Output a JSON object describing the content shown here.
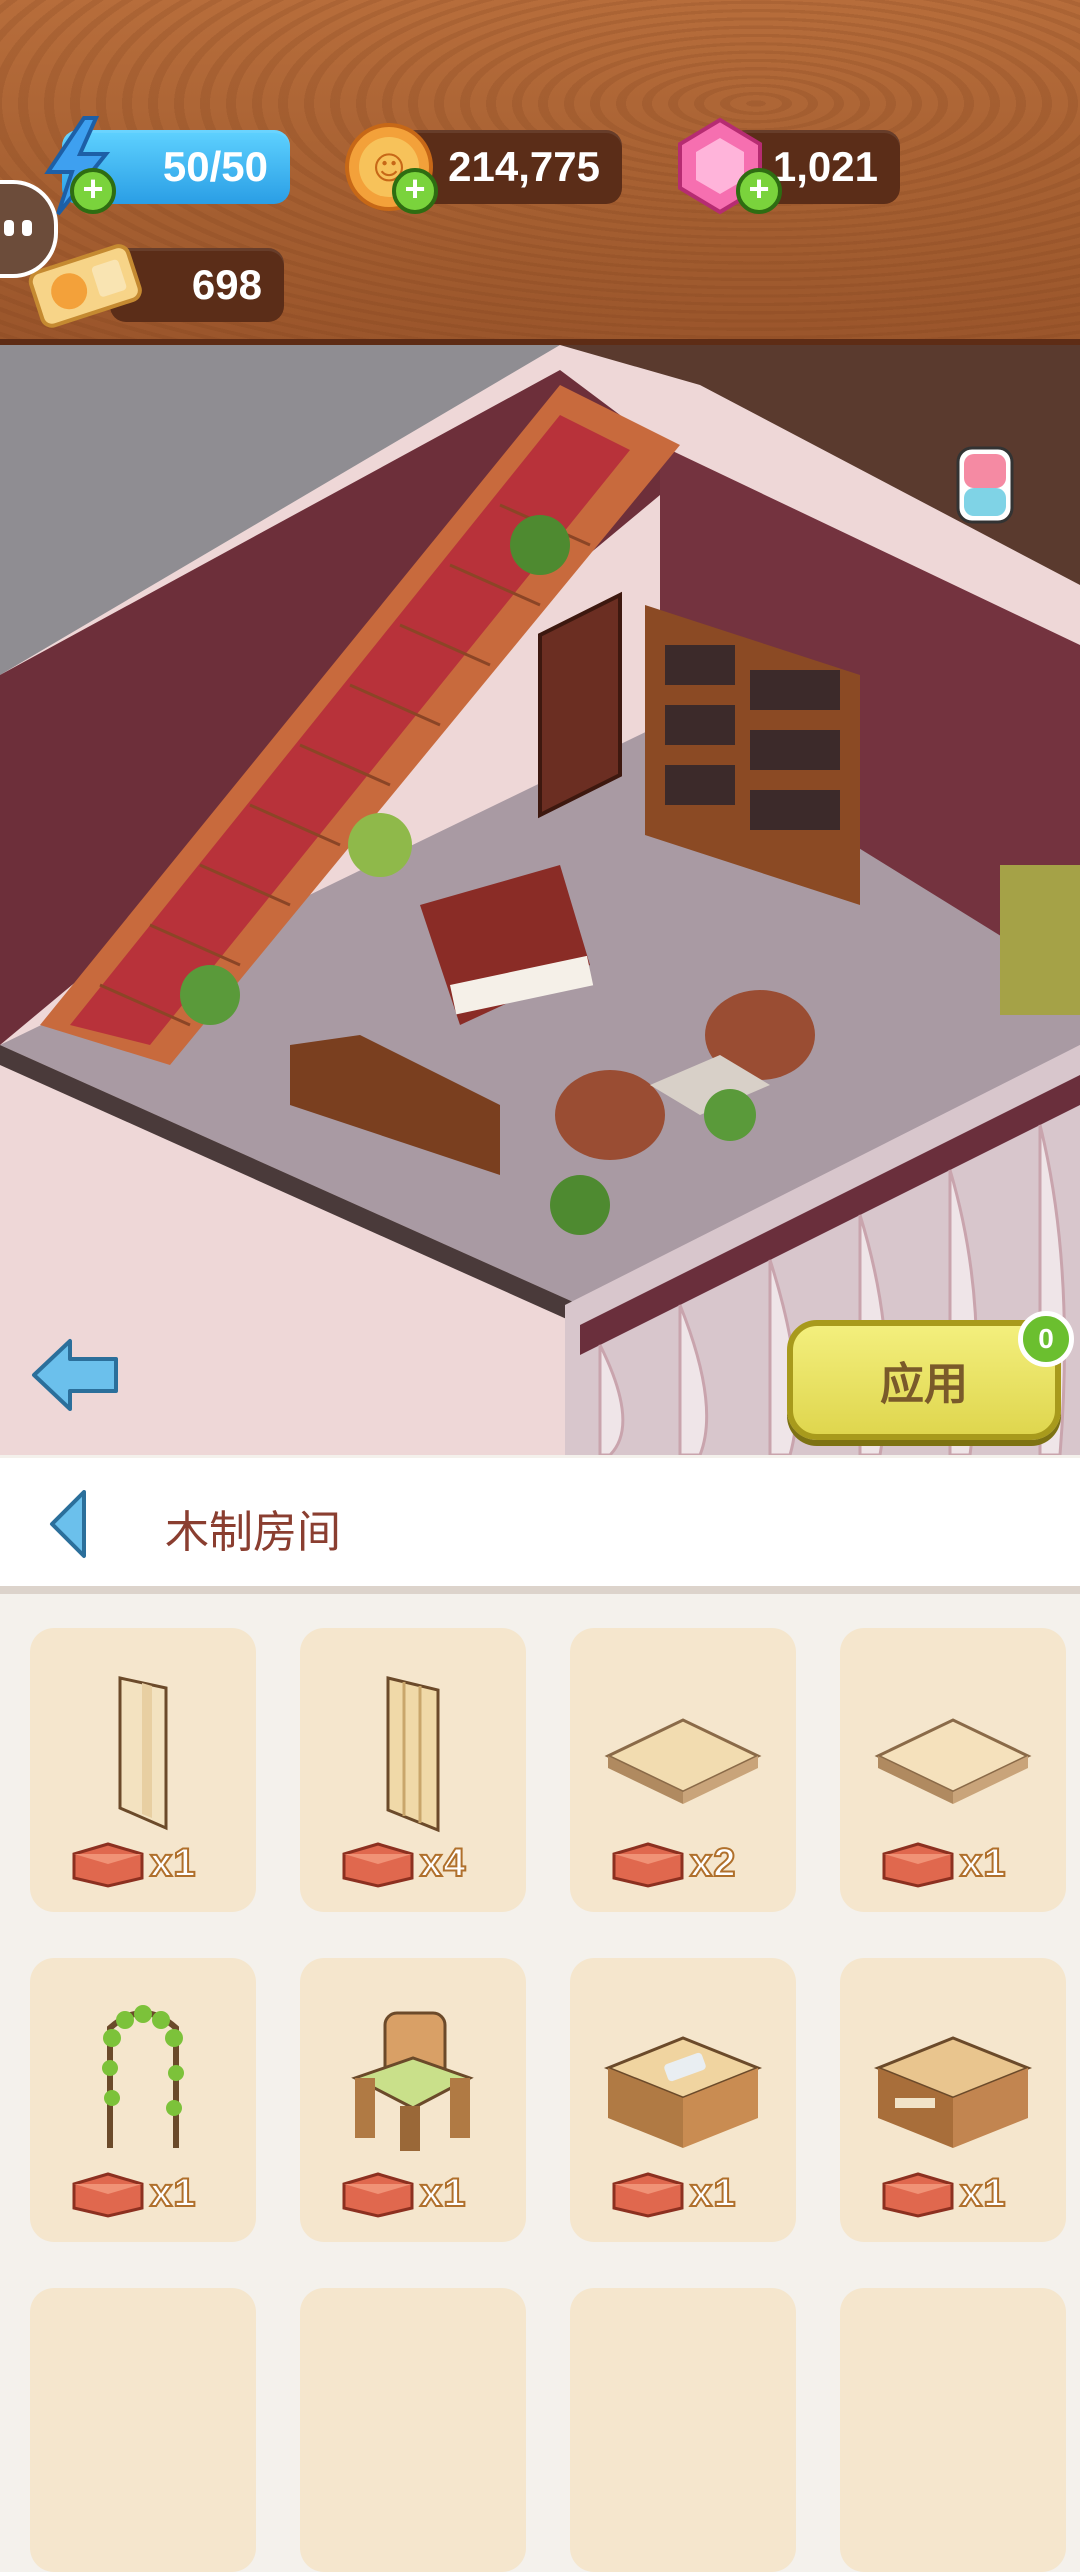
{
  "resources": {
    "energy": "50/50",
    "coins": "214,775",
    "gems": "1,021",
    "tickets": "698",
    "energy_icon": "lightning-icon",
    "coin_icon": "coin-icon",
    "gem_icon": "gem-icon",
    "ticket_icon": "ticket-icon"
  },
  "scene": {
    "apply_label": "应用",
    "apply_badge": "0"
  },
  "category": {
    "title": "木制房间"
  },
  "items": [
    {
      "name": "wooden-wall-plain",
      "count": "x1"
    },
    {
      "name": "wooden-wall-plank",
      "count": "x4"
    },
    {
      "name": "wooden-floor-tile-a",
      "count": "x2"
    },
    {
      "name": "wooden-floor-tile-b",
      "count": "x1"
    },
    {
      "name": "ivy-arch",
      "count": "x1"
    },
    {
      "name": "wooden-armchair",
      "count": "x1"
    },
    {
      "name": "wooden-sink-counter",
      "count": "x1"
    },
    {
      "name": "wooden-shelf-table",
      "count": "x1"
    }
  ],
  "colors": {
    "wood_bar": "#a55f31",
    "card_bg": "#f5e6cd",
    "apply_button": "#e7df5c",
    "title_text": "#8a3e30"
  }
}
